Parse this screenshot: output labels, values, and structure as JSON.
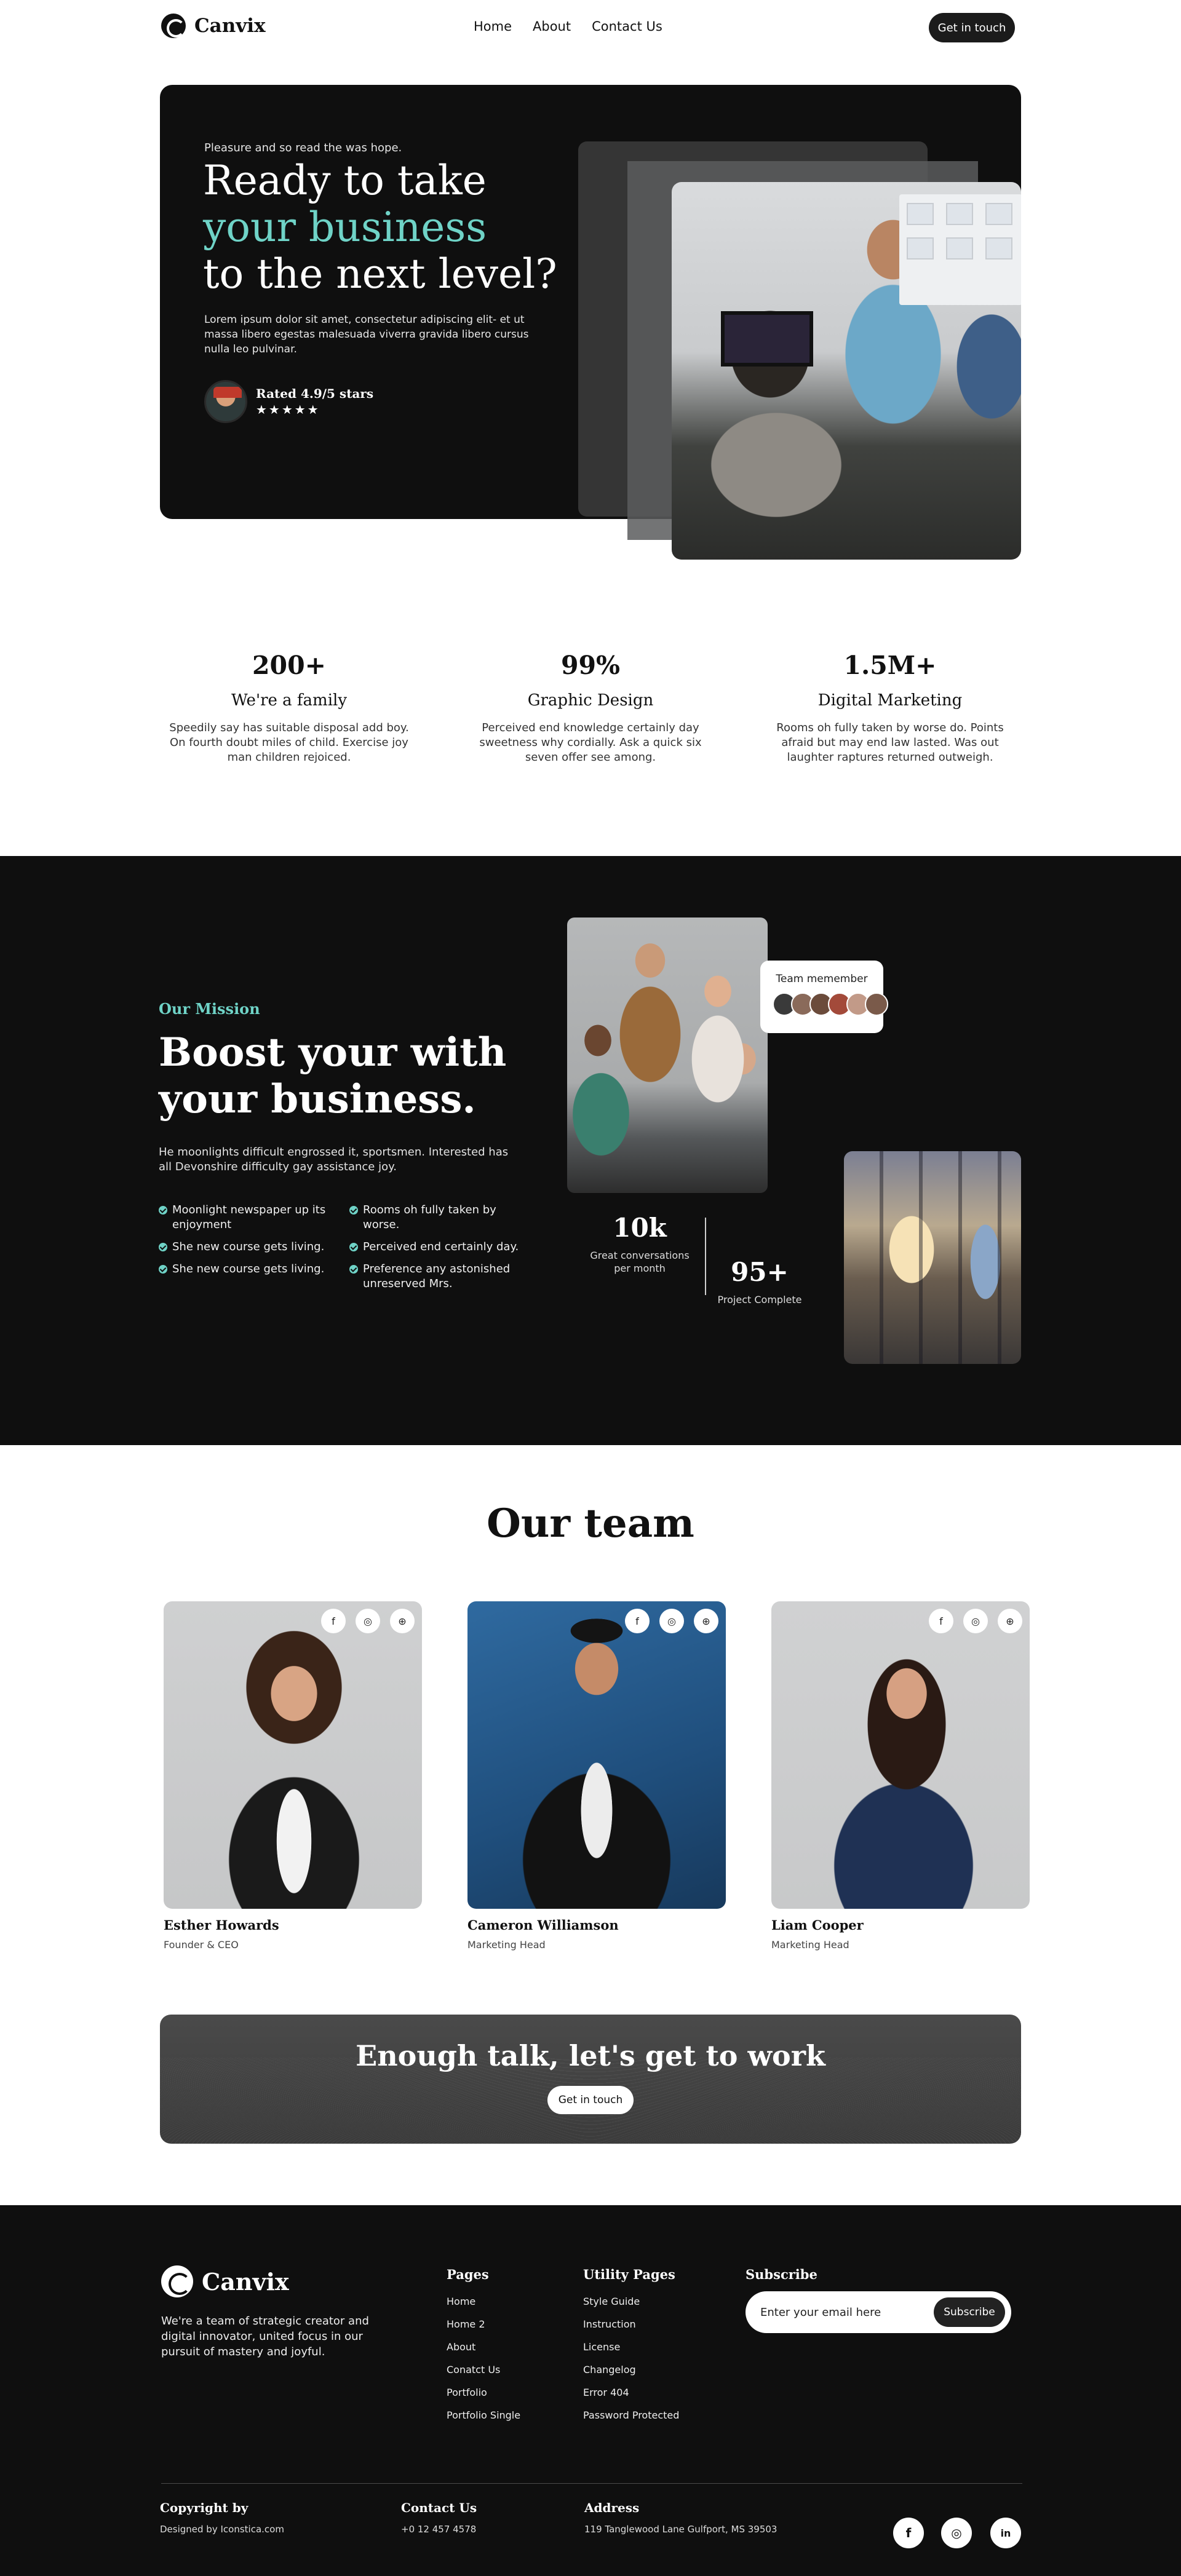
{
  "nav": {
    "brand": "Canvix",
    "links": [
      "Home",
      "About",
      "Contact Us"
    ],
    "cta": "Get in touch"
  },
  "hero": {
    "kicker": "Pleasure and so read the was hope.",
    "title_line1": "Ready to take",
    "title_accent": "your business",
    "title_line3": "to the next level?",
    "body": "Lorem ipsum dolor sit amet, consectetur adipiscing elit- et ut massa libero egestas malesuada viverra gravida libero cursus nulla leo pulvinar.",
    "rating": "Rated 4.9/5 stars",
    "stars": "★★★★★"
  },
  "stats": [
    {
      "number": "200+",
      "title": "We're a family",
      "desc": "Speedily say has suitable disposal add boy. On fourth doubt miles of child. Exercise joy man children rejoiced."
    },
    {
      "number": "99%",
      "title": "Graphic Design",
      "desc": "Perceived end knowledge certainly day sweetness why cordially. Ask a quick six seven offer see among."
    },
    {
      "number": "1.5M+",
      "title": "Digital Marketing",
      "desc": "Rooms oh fully taken by worse do. Points afraid but may end law lasted. Was out laughter raptures returned outweigh."
    }
  ],
  "mission": {
    "kicker": "Our Mission",
    "title": "Boost your with your business.",
    "body": "He moonlights difficult engrossed it, sportsmen. Interested has all Devonshire difficulty gay assistance joy.",
    "checks_left": [
      "Moonlight newspaper up its enjoyment",
      "She new course gets living.",
      "She new course gets living."
    ],
    "checks_right": [
      "Rooms oh fully taken by worse.",
      "Perceived end certainly day.",
      "Preference any astonished unreserved Mrs."
    ],
    "badge_label": "Team memember",
    "stat1_num": "10k",
    "stat1_label": "Great conversations per month",
    "stat2_num": "95+",
    "stat2_label": "Project Complete"
  },
  "team": {
    "title": "Our team",
    "members": [
      {
        "name": "Esther Howards",
        "role": "Founder & CEO"
      },
      {
        "name": "Cameron Williamson",
        "role": "Marketing Head"
      },
      {
        "name": "Liam Cooper",
        "role": "Marketing Head"
      }
    ]
  },
  "cta": {
    "title": "Enough talk, let's get to work",
    "button": "Get in touch"
  },
  "footer": {
    "brand": "Canvix",
    "about": "We're a team of strategic creator and digital innovator, united focus in our pursuit of mastery and joyful.",
    "pages_title": "Pages",
    "pages": [
      "Home",
      "Home 2",
      "About",
      "Conatct Us",
      "Portfolio",
      "Portfolio Single"
    ],
    "utility_title": "Utility Pages",
    "utility": [
      "Style Guide",
      "Instruction",
      "License",
      "Changelog",
      "Error  404",
      "Password Protected"
    ],
    "subscribe_title": "Subscribe",
    "email_placeholder": "Enter your email here",
    "subscribe_button": "Subscribe",
    "copyright_title": "Copyright by",
    "copyright_text": "Designed by Iconstica.com",
    "contact_title": "Contact Us",
    "contact_text": "+0 12 457 4578",
    "address_title": "Address",
    "address_text": "119 Tanglewood Lane Gulfport, MS 39503"
  },
  "colors": {
    "accent": "#6fd3c7",
    "dark": "#0f0f0f"
  }
}
